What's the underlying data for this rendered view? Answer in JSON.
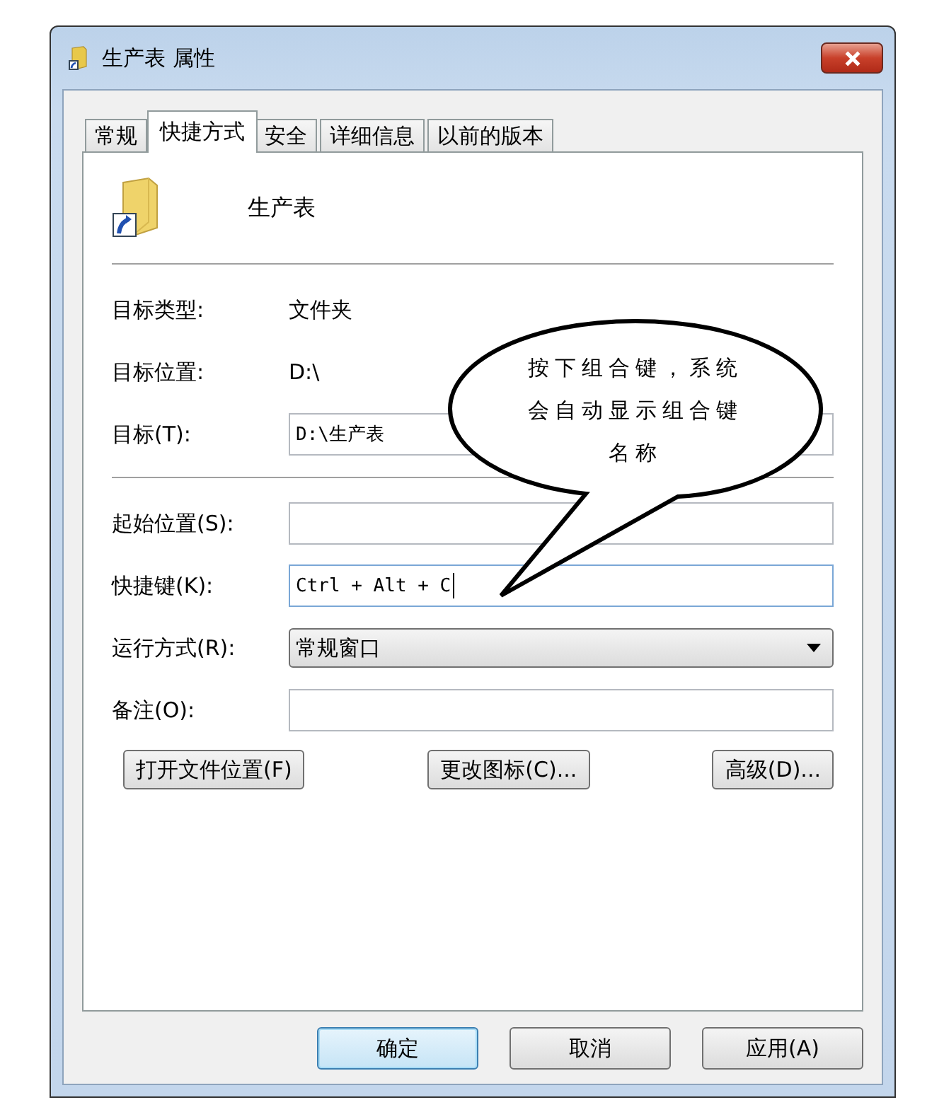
{
  "window": {
    "title": "生产表 属性"
  },
  "tabs": [
    {
      "label": "常规",
      "selected": false
    },
    {
      "label": "快捷方式",
      "selected": true
    },
    {
      "label": "安全",
      "selected": false
    },
    {
      "label": "详细信息",
      "selected": false
    },
    {
      "label": "以前的版本",
      "selected": false
    }
  ],
  "header": {
    "name": "生产表"
  },
  "fields": [
    {
      "kind": "info",
      "label": "目标类型:",
      "value": "文件夹"
    },
    {
      "kind": "info",
      "label": "目标位置:",
      "value": "D:\\"
    },
    {
      "kind": "input",
      "label": "目标(T):",
      "value": "D:\\生产表",
      "focused": false
    },
    {
      "kind": "separator"
    },
    {
      "kind": "input",
      "label": "起始位置(S):",
      "focused": false
    },
    {
      "kind": "input",
      "label": "快捷键(K):",
      "value": "Ctrl + Alt + C",
      "focused": true
    },
    {
      "kind": "dropdown",
      "label": "运行方式(R):",
      "value": "常规窗口"
    },
    {
      "kind": "input",
      "label": "备注(O):",
      "focused": false
    }
  ],
  "actions": [
    "打开文件位置(F)",
    "更改图标(C)...",
    "高级(D)..."
  ],
  "callout": {
    "text": "按下组合键，系统会自动显示组合键名称"
  },
  "dialog_buttons": [
    {
      "label": "确定",
      "default": true
    },
    {
      "label": "取消",
      "default": false
    },
    {
      "label": "应用(A)",
      "default": false
    }
  ]
}
